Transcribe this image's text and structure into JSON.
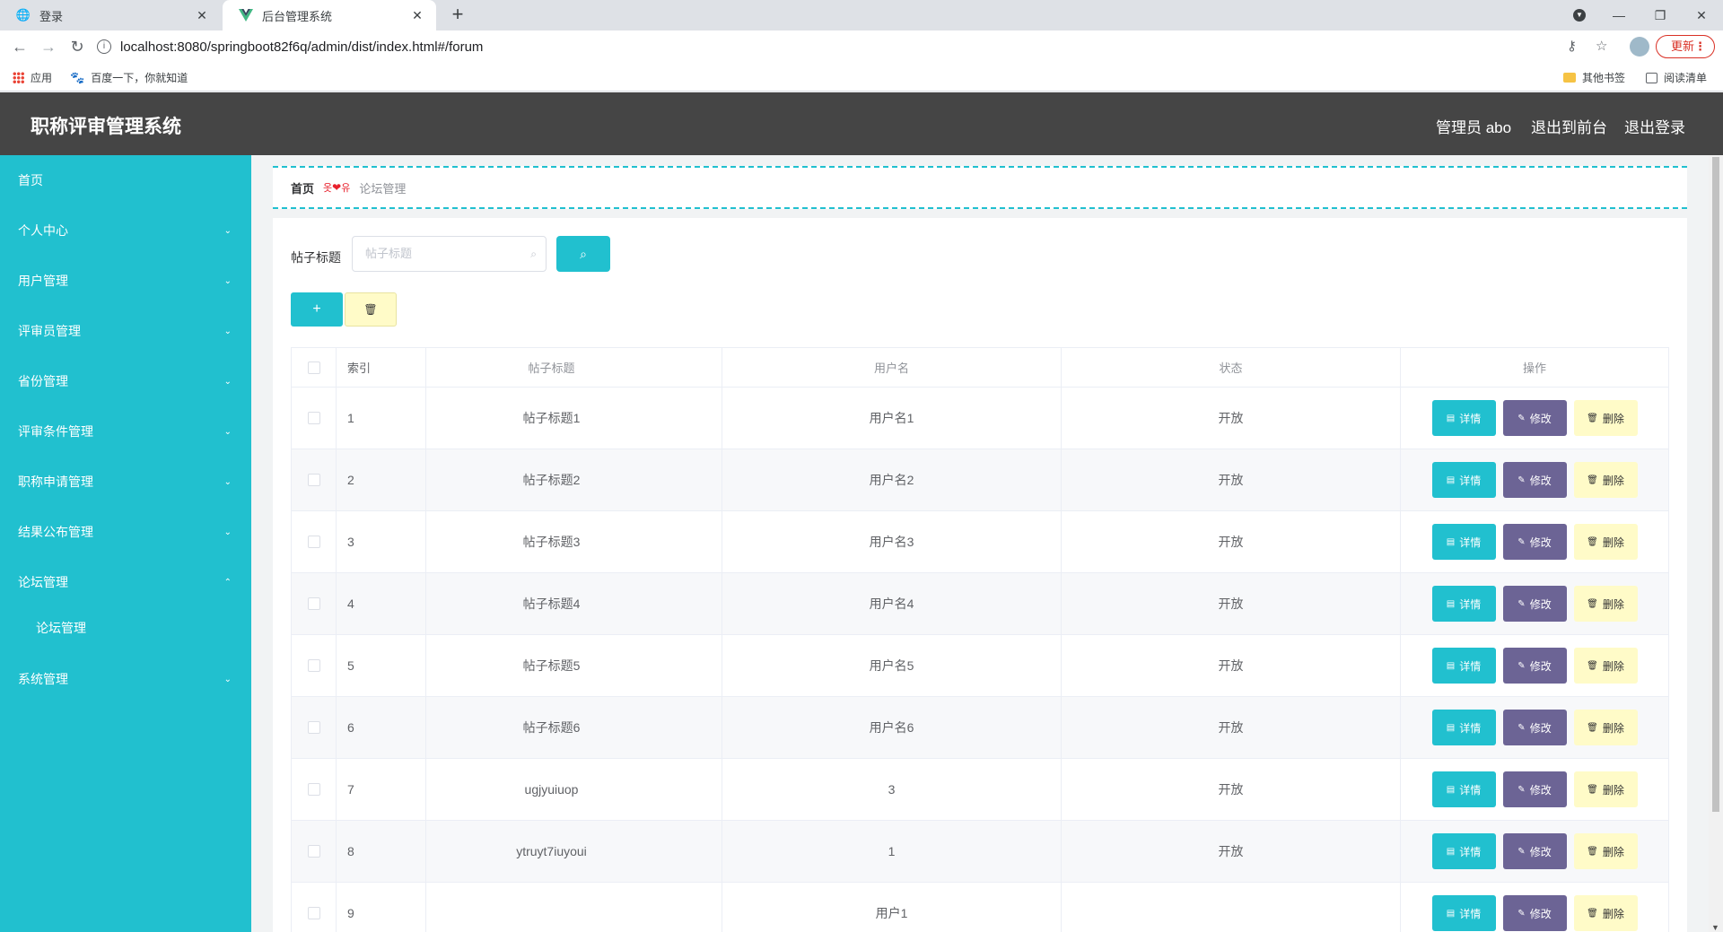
{
  "browser": {
    "tabs": [
      {
        "title": "登录",
        "icon": "globe-icon"
      },
      {
        "title": "后台管理系统",
        "icon": "vue-logo-icon"
      }
    ],
    "url": "localhost:8080/springboot82f6q/admin/dist/index.html#/forum",
    "update_label": "更新",
    "bookmarks": [
      {
        "label": "应用",
        "icon": "apps-grid-icon"
      },
      {
        "label": "百度一下，你就知道",
        "icon": "baidu-paw-icon"
      }
    ],
    "bookmarks_right": [
      {
        "label": "其他书签",
        "icon": "folder-icon"
      },
      {
        "label": "阅读清单",
        "icon": "reading-list-icon"
      }
    ]
  },
  "header": {
    "title": "职称评审管理系统",
    "user": "管理员 abo",
    "to_front": "退出到前台",
    "logout": "退出登录",
    "bg_color": "#454545"
  },
  "sidebar": {
    "accent": "#21c0cf",
    "items": [
      {
        "label": "首页",
        "expandable": false
      },
      {
        "label": "个人中心",
        "expandable": true
      },
      {
        "label": "用户管理",
        "expandable": true
      },
      {
        "label": "评审员管理",
        "expandable": true
      },
      {
        "label": "省份管理",
        "expandable": true
      },
      {
        "label": "评审条件管理",
        "expandable": true
      },
      {
        "label": "职称申请管理",
        "expandable": true
      },
      {
        "label": "结果公布管理",
        "expandable": true
      },
      {
        "label": "论坛管理",
        "expandable": true,
        "expanded": true
      },
      {
        "label": "论坛管理",
        "sub": true
      },
      {
        "label": "系统管理",
        "expandable": true
      }
    ]
  },
  "breadcrumb": {
    "home": "首页",
    "separator": "❤",
    "current": "论坛管理"
  },
  "search": {
    "label": "帖子标题",
    "placeholder": "帖子标题"
  },
  "table": {
    "columns": [
      "索引",
      "帖子标题",
      "用户名",
      "状态",
      "操作"
    ],
    "actions": {
      "detail": "详情",
      "edit": "修改",
      "delete": "删除"
    },
    "rows": [
      {
        "index": "1",
        "title": "帖子标题1",
        "user": "用户名1",
        "status": "开放"
      },
      {
        "index": "2",
        "title": "帖子标题2",
        "user": "用户名2",
        "status": "开放"
      },
      {
        "index": "3",
        "title": "帖子标题3",
        "user": "用户名3",
        "status": "开放"
      },
      {
        "index": "4",
        "title": "帖子标题4",
        "user": "用户名4",
        "status": "开放"
      },
      {
        "index": "5",
        "title": "帖子标题5",
        "user": "用户名5",
        "status": "开放"
      },
      {
        "index": "6",
        "title": "帖子标题6",
        "user": "用户名6",
        "status": "开放"
      },
      {
        "index": "7",
        "title": "ugjyuiuop",
        "user": "3",
        "status": "开放"
      },
      {
        "index": "8",
        "title": "ytruyt7iuyoui",
        "user": "1",
        "status": "开放"
      },
      {
        "index": "9",
        "title": "",
        "user": "用户1",
        "status": ""
      }
    ]
  }
}
